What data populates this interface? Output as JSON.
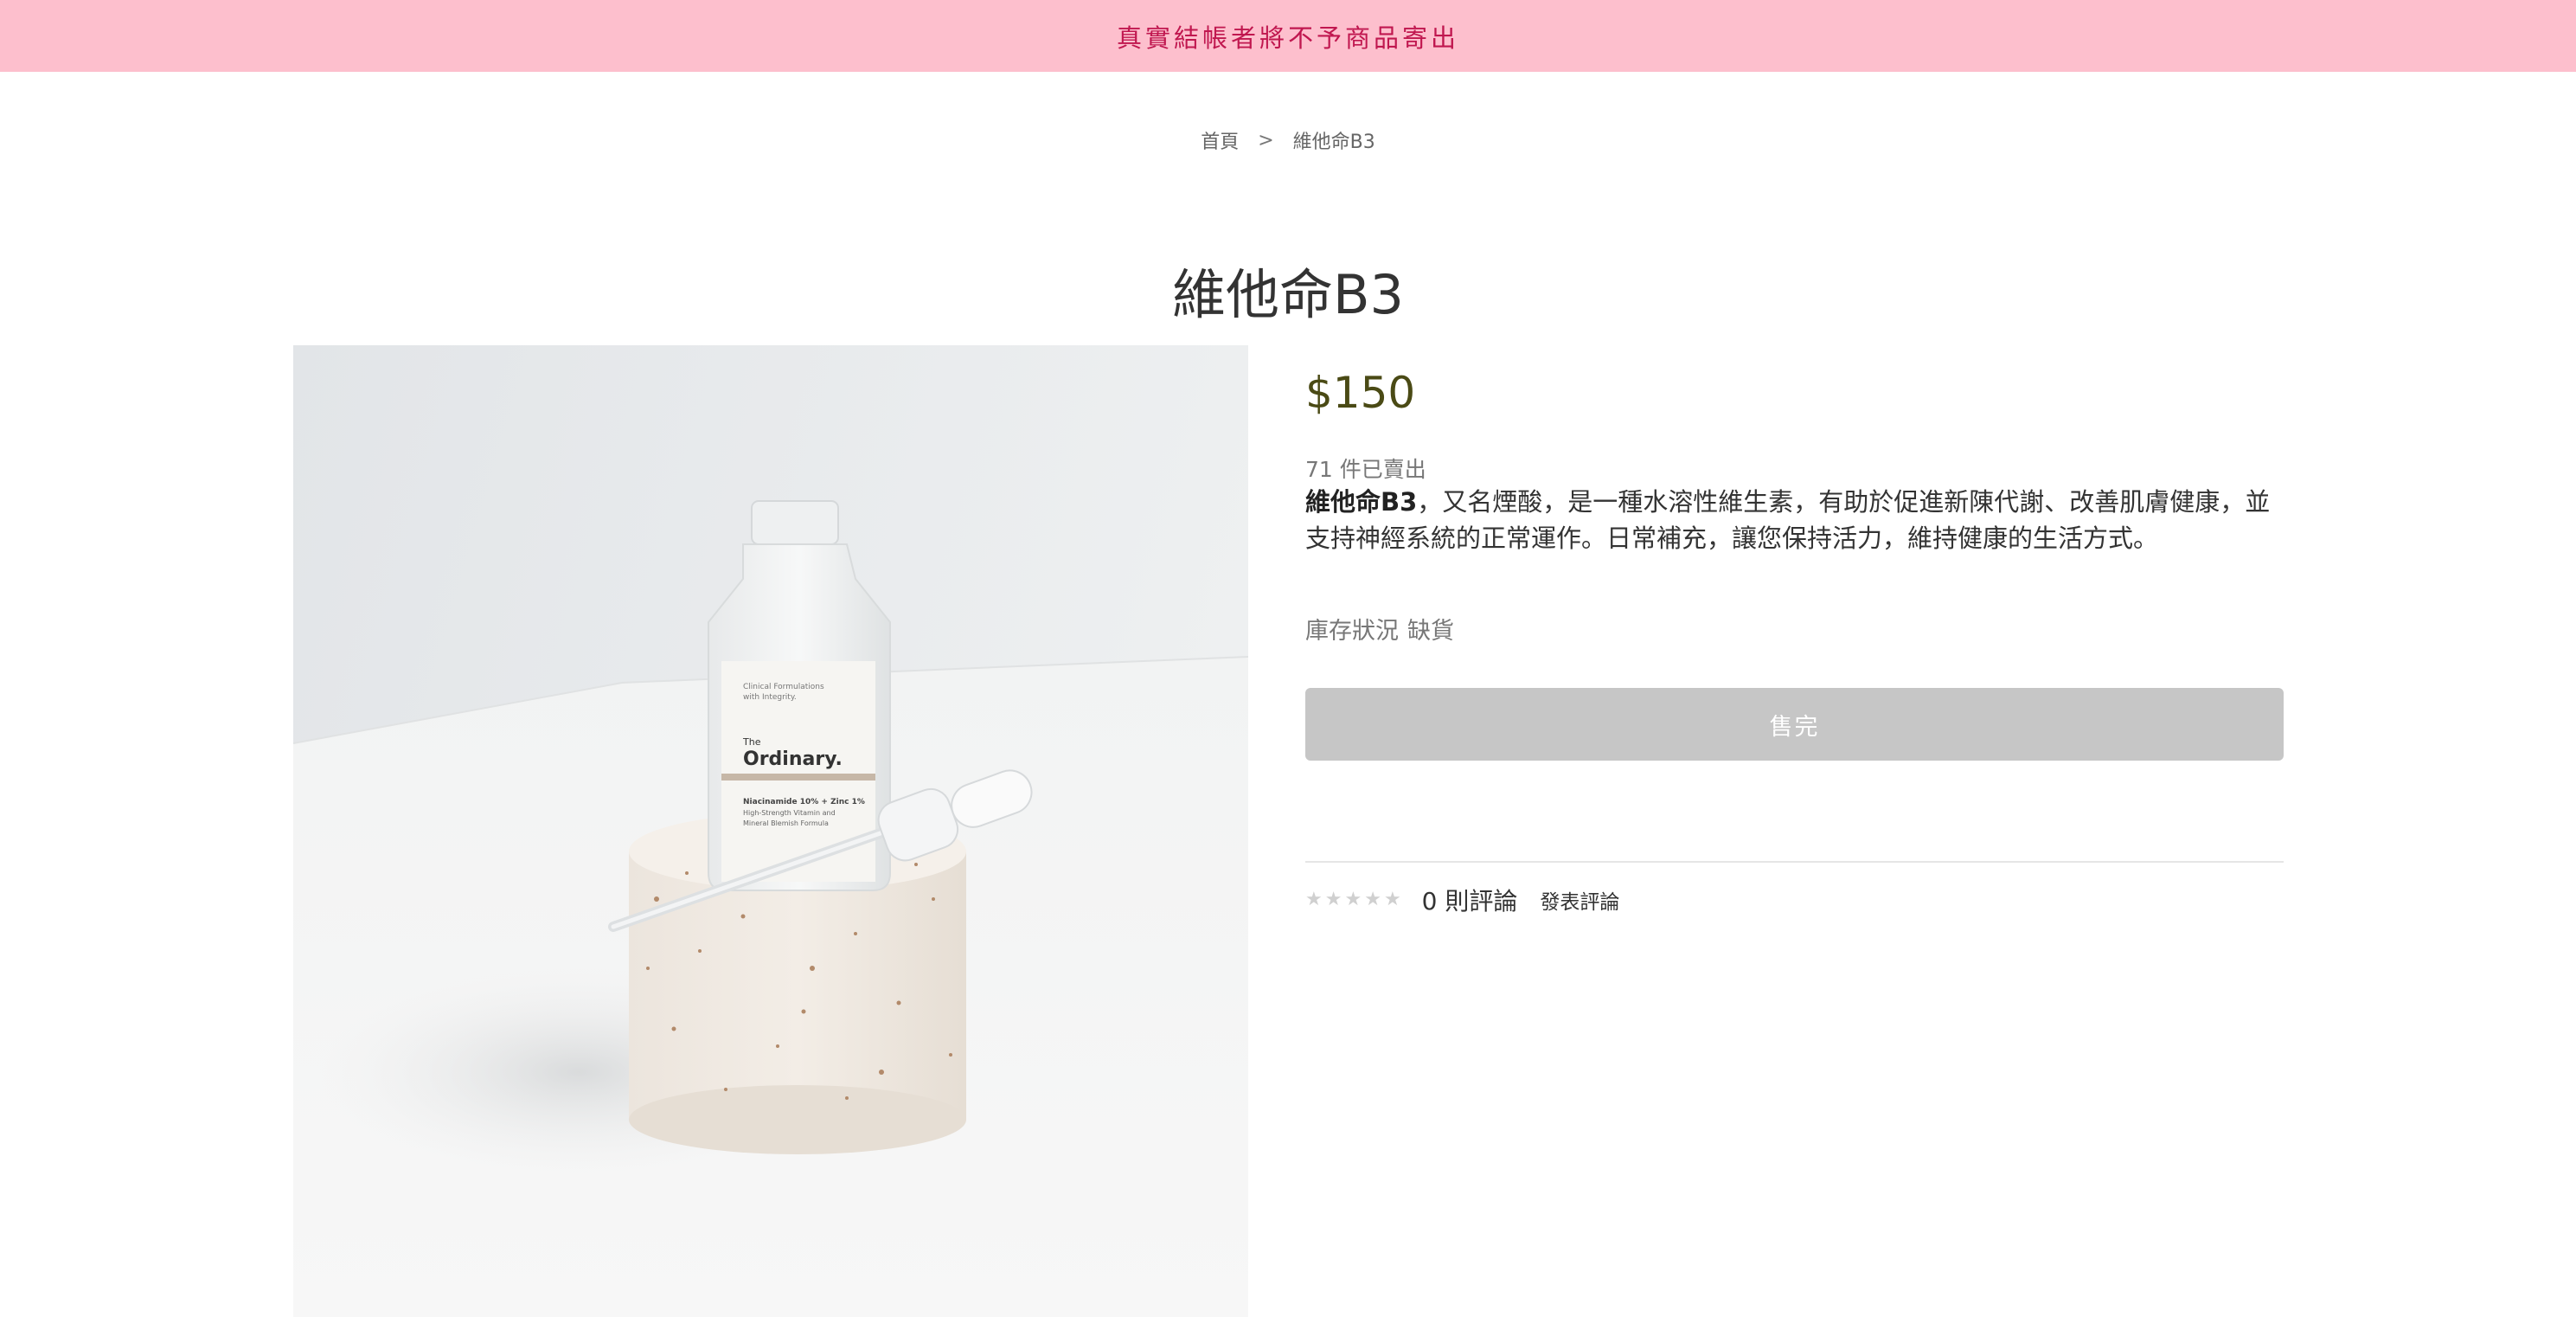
{
  "announcement": {
    "text": "真實結帳者將不予商品寄出",
    "background": "#fdbfcd",
    "color": "#c0174f"
  },
  "breadcrumb": {
    "home": "首頁",
    "separator": ">",
    "current": "維他命B3"
  },
  "product": {
    "title": "維他命B3",
    "price": "$150",
    "sold_count": "71 件已賣出",
    "description_lead": "維他命B3",
    "description_rest": "，又名煙酸，是一種水溶性維生素，有助於促進新陳代謝、改善肌膚健康，並支持神經系統的正常運作。日常補充，讓您保持活力，維持健康的生活方式。",
    "stock_label": "庫存狀況",
    "stock_value": "缺貨",
    "soldout_button": "售完",
    "image": {
      "label_line1": "Clinical Formulations",
      "label_line2": "with Integrity.",
      "brand_prefix": "The",
      "brand": "Ordinary.",
      "product_name": "Niacinamide 10% + Zinc 1%",
      "sub1": "High-Strength Vitamin and",
      "sub2": "Mineral Blemish Formula"
    }
  },
  "reviews": {
    "stars": [
      "★",
      "★",
      "★",
      "★",
      "★"
    ],
    "count_text": "0 則評論",
    "write_review": "發表評論"
  },
  "colors": {
    "price": "#4a4a15",
    "button_disabled": "#c6c6c6"
  }
}
